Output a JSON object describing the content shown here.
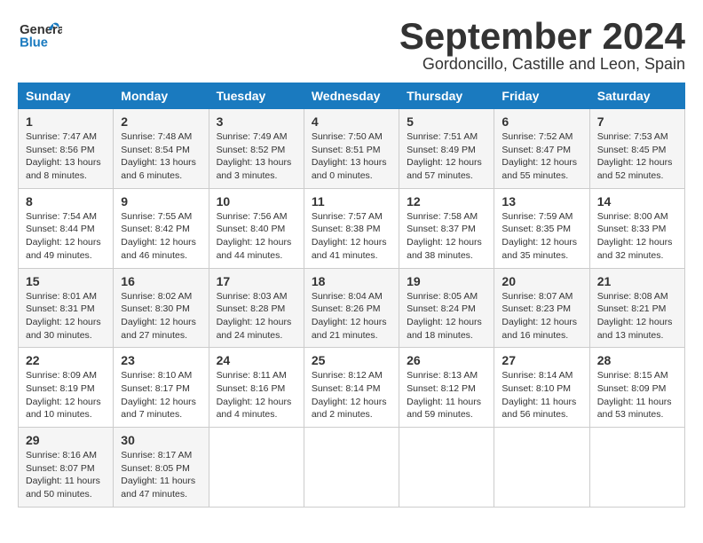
{
  "header": {
    "logo_line1": "General",
    "logo_line2": "Blue",
    "month_title": "September 2024",
    "location": "Gordoncillo, Castille and Leon, Spain"
  },
  "weekdays": [
    "Sunday",
    "Monday",
    "Tuesday",
    "Wednesday",
    "Thursday",
    "Friday",
    "Saturday"
  ],
  "weeks": [
    [
      {
        "day": "1",
        "sunrise": "Sunrise: 7:47 AM",
        "sunset": "Sunset: 8:56 PM",
        "daylight": "Daylight: 13 hours and 8 minutes."
      },
      {
        "day": "2",
        "sunrise": "Sunrise: 7:48 AM",
        "sunset": "Sunset: 8:54 PM",
        "daylight": "Daylight: 13 hours and 6 minutes."
      },
      {
        "day": "3",
        "sunrise": "Sunrise: 7:49 AM",
        "sunset": "Sunset: 8:52 PM",
        "daylight": "Daylight: 13 hours and 3 minutes."
      },
      {
        "day": "4",
        "sunrise": "Sunrise: 7:50 AM",
        "sunset": "Sunset: 8:51 PM",
        "daylight": "Daylight: 13 hours and 0 minutes."
      },
      {
        "day": "5",
        "sunrise": "Sunrise: 7:51 AM",
        "sunset": "Sunset: 8:49 PM",
        "daylight": "Daylight: 12 hours and 57 minutes."
      },
      {
        "day": "6",
        "sunrise": "Sunrise: 7:52 AM",
        "sunset": "Sunset: 8:47 PM",
        "daylight": "Daylight: 12 hours and 55 minutes."
      },
      {
        "day": "7",
        "sunrise": "Sunrise: 7:53 AM",
        "sunset": "Sunset: 8:45 PM",
        "daylight": "Daylight: 12 hours and 52 minutes."
      }
    ],
    [
      {
        "day": "8",
        "sunrise": "Sunrise: 7:54 AM",
        "sunset": "Sunset: 8:44 PM",
        "daylight": "Daylight: 12 hours and 49 minutes."
      },
      {
        "day": "9",
        "sunrise": "Sunrise: 7:55 AM",
        "sunset": "Sunset: 8:42 PM",
        "daylight": "Daylight: 12 hours and 46 minutes."
      },
      {
        "day": "10",
        "sunrise": "Sunrise: 7:56 AM",
        "sunset": "Sunset: 8:40 PM",
        "daylight": "Daylight: 12 hours and 44 minutes."
      },
      {
        "day": "11",
        "sunrise": "Sunrise: 7:57 AM",
        "sunset": "Sunset: 8:38 PM",
        "daylight": "Daylight: 12 hours and 41 minutes."
      },
      {
        "day": "12",
        "sunrise": "Sunrise: 7:58 AM",
        "sunset": "Sunset: 8:37 PM",
        "daylight": "Daylight: 12 hours and 38 minutes."
      },
      {
        "day": "13",
        "sunrise": "Sunrise: 7:59 AM",
        "sunset": "Sunset: 8:35 PM",
        "daylight": "Daylight: 12 hours and 35 minutes."
      },
      {
        "day": "14",
        "sunrise": "Sunrise: 8:00 AM",
        "sunset": "Sunset: 8:33 PM",
        "daylight": "Daylight: 12 hours and 32 minutes."
      }
    ],
    [
      {
        "day": "15",
        "sunrise": "Sunrise: 8:01 AM",
        "sunset": "Sunset: 8:31 PM",
        "daylight": "Daylight: 12 hours and 30 minutes."
      },
      {
        "day": "16",
        "sunrise": "Sunrise: 8:02 AM",
        "sunset": "Sunset: 8:30 PM",
        "daylight": "Daylight: 12 hours and 27 minutes."
      },
      {
        "day": "17",
        "sunrise": "Sunrise: 8:03 AM",
        "sunset": "Sunset: 8:28 PM",
        "daylight": "Daylight: 12 hours and 24 minutes."
      },
      {
        "day": "18",
        "sunrise": "Sunrise: 8:04 AM",
        "sunset": "Sunset: 8:26 PM",
        "daylight": "Daylight: 12 hours and 21 minutes."
      },
      {
        "day": "19",
        "sunrise": "Sunrise: 8:05 AM",
        "sunset": "Sunset: 8:24 PM",
        "daylight": "Daylight: 12 hours and 18 minutes."
      },
      {
        "day": "20",
        "sunrise": "Sunrise: 8:07 AM",
        "sunset": "Sunset: 8:23 PM",
        "daylight": "Daylight: 12 hours and 16 minutes."
      },
      {
        "day": "21",
        "sunrise": "Sunrise: 8:08 AM",
        "sunset": "Sunset: 8:21 PM",
        "daylight": "Daylight: 12 hours and 13 minutes."
      }
    ],
    [
      {
        "day": "22",
        "sunrise": "Sunrise: 8:09 AM",
        "sunset": "Sunset: 8:19 PM",
        "daylight": "Daylight: 12 hours and 10 minutes."
      },
      {
        "day": "23",
        "sunrise": "Sunrise: 8:10 AM",
        "sunset": "Sunset: 8:17 PM",
        "daylight": "Daylight: 12 hours and 7 minutes."
      },
      {
        "day": "24",
        "sunrise": "Sunrise: 8:11 AM",
        "sunset": "Sunset: 8:16 PM",
        "daylight": "Daylight: 12 hours and 4 minutes."
      },
      {
        "day": "25",
        "sunrise": "Sunrise: 8:12 AM",
        "sunset": "Sunset: 8:14 PM",
        "daylight": "Daylight: 12 hours and 2 minutes."
      },
      {
        "day": "26",
        "sunrise": "Sunrise: 8:13 AM",
        "sunset": "Sunset: 8:12 PM",
        "daylight": "Daylight: 11 hours and 59 minutes."
      },
      {
        "day": "27",
        "sunrise": "Sunrise: 8:14 AM",
        "sunset": "Sunset: 8:10 PM",
        "daylight": "Daylight: 11 hours and 56 minutes."
      },
      {
        "day": "28",
        "sunrise": "Sunrise: 8:15 AM",
        "sunset": "Sunset: 8:09 PM",
        "daylight": "Daylight: 11 hours and 53 minutes."
      }
    ],
    [
      {
        "day": "29",
        "sunrise": "Sunrise: 8:16 AM",
        "sunset": "Sunset: 8:07 PM",
        "daylight": "Daylight: 11 hours and 50 minutes."
      },
      {
        "day": "30",
        "sunrise": "Sunrise: 8:17 AM",
        "sunset": "Sunset: 8:05 PM",
        "daylight": "Daylight: 11 hours and 47 minutes."
      },
      null,
      null,
      null,
      null,
      null
    ]
  ]
}
